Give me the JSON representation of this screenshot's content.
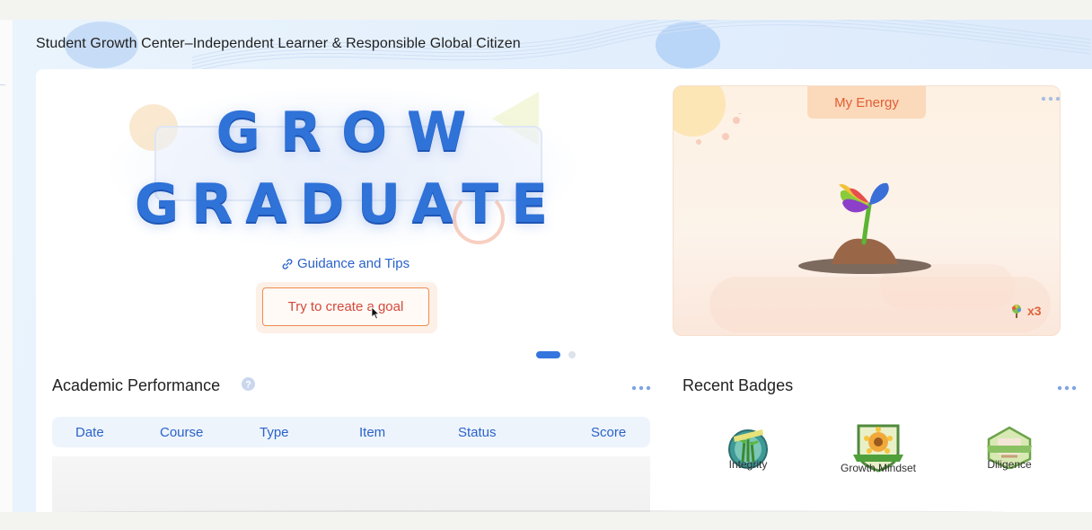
{
  "page": {
    "title": "Student Growth Center–Independent Learner & Responsible Global Citizen"
  },
  "hero": {
    "line1": "GROW",
    "line2": "GRADUATE",
    "guidance_link": "Guidance and Tips",
    "cta_button": "Try to create a goal",
    "carousel": {
      "total": 2,
      "active": 1
    }
  },
  "energy": {
    "tab_label": "My Energy",
    "tree_count": "x3",
    "icons": {
      "more": "more-dots-icon",
      "plant": "sprout-icon",
      "tree": "tree-icon"
    }
  },
  "academic": {
    "title": "Academic Performance",
    "columns": [
      "Date",
      "Course",
      "Type",
      "Item",
      "Status",
      "Score"
    ],
    "rows": [],
    "icons": {
      "help": "help-circle-icon",
      "more": "more-dots-icon"
    }
  },
  "badges": {
    "title": "Recent Badges",
    "items": [
      {
        "label": "Integrity",
        "icon": "integrity-badge-icon"
      },
      {
        "label": "Growth Mindset",
        "icon": "growth-mindset-badge-icon"
      },
      {
        "label": "Diligence",
        "icon": "diligence-badge-icon"
      }
    ]
  },
  "colors": {
    "accent_blue": "#3475de",
    "link_blue": "#2a62c9",
    "cta_border": "#ee8d4f",
    "cta_text": "#d4483a",
    "energy_accent": "#e05e34"
  }
}
